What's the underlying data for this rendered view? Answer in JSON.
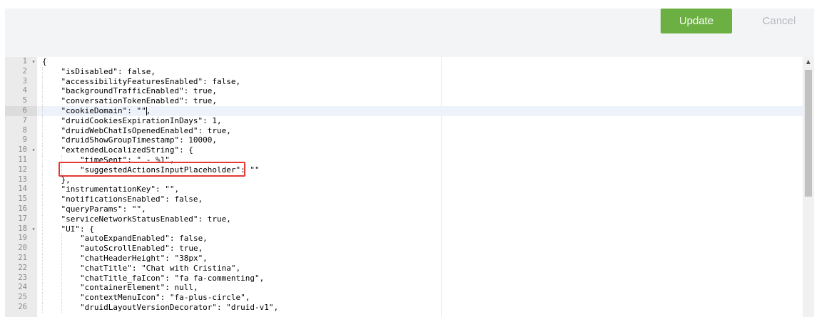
{
  "toolbar": {
    "update_label": "Update",
    "cancel_label": "Cancel",
    "update_color": "#6cb043"
  },
  "editor": {
    "active_line": 6,
    "highlight_color": "#e53935",
    "lines": [
      {
        "n": "1",
        "fold": true,
        "indent": 0,
        "text": "{"
      },
      {
        "n": "2",
        "indent": 1,
        "text": "\"isDisabled\": false,"
      },
      {
        "n": "3",
        "indent": 1,
        "text": "\"accessibilityFeaturesEnabled\": false,"
      },
      {
        "n": "4",
        "indent": 1,
        "text": "\"backgroundTrafficEnabled\": true,"
      },
      {
        "n": "5",
        "indent": 1,
        "text": "\"conversationTokenEnabled\": true,"
      },
      {
        "n": "6",
        "indent": 1,
        "text": "\"cookieDomain\": \"\","
      },
      {
        "n": "7",
        "indent": 1,
        "text": "\"druidCookiesExpirationInDays\": 1,"
      },
      {
        "n": "8",
        "indent": 1,
        "text": "\"druidWebChatIsOpenedEnabled\": true,"
      },
      {
        "n": "9",
        "indent": 1,
        "text": "\"druidShowGroupTimestamp\": 10000,"
      },
      {
        "n": "10",
        "fold": true,
        "indent": 1,
        "text": "\"extendedLocalizedString\": {"
      },
      {
        "n": "11",
        "indent": 2,
        "text": "\"timeSent\": \" - %1\","
      },
      {
        "n": "12",
        "indent": 2,
        "text": "\"suggestedActionsInputPlaceholder\": \"\""
      },
      {
        "n": "13",
        "indent": 1,
        "text": "},"
      },
      {
        "n": "14",
        "indent": 1,
        "text": "\"instrumentationKey\": \"\","
      },
      {
        "n": "15",
        "indent": 1,
        "text": "\"notificationsEnabled\": false,"
      },
      {
        "n": "16",
        "indent": 1,
        "text": "\"queryParams\": \"\","
      },
      {
        "n": "17",
        "indent": 1,
        "text": "\"serviceNetworkStatusEnabled\": true,"
      },
      {
        "n": "18",
        "fold": true,
        "indent": 1,
        "text": "\"UI\": {"
      },
      {
        "n": "19",
        "indent": 2,
        "text": "\"autoExpandEnabled\": false,"
      },
      {
        "n": "20",
        "indent": 2,
        "text": "\"autoScrollEnabled\": true,"
      },
      {
        "n": "21",
        "indent": 2,
        "text": "\"chatHeaderHeight\": \"38px\","
      },
      {
        "n": "22",
        "indent": 2,
        "text": "\"chatTitle\": \"Chat with Cristina\","
      },
      {
        "n": "23",
        "indent": 2,
        "text": "\"chatTitle_faIcon\": \"fa fa-commenting\","
      },
      {
        "n": "24",
        "indent": 2,
        "text": "\"containerElement\": null,"
      },
      {
        "n": "25",
        "indent": 2,
        "text": "\"contextMenuIcon\": \"fa-plus-circle\","
      },
      {
        "n": "26",
        "indent": 2,
        "text": "\"druidLayoutVersionDecorator\": \"druid-v1\","
      }
    ]
  }
}
